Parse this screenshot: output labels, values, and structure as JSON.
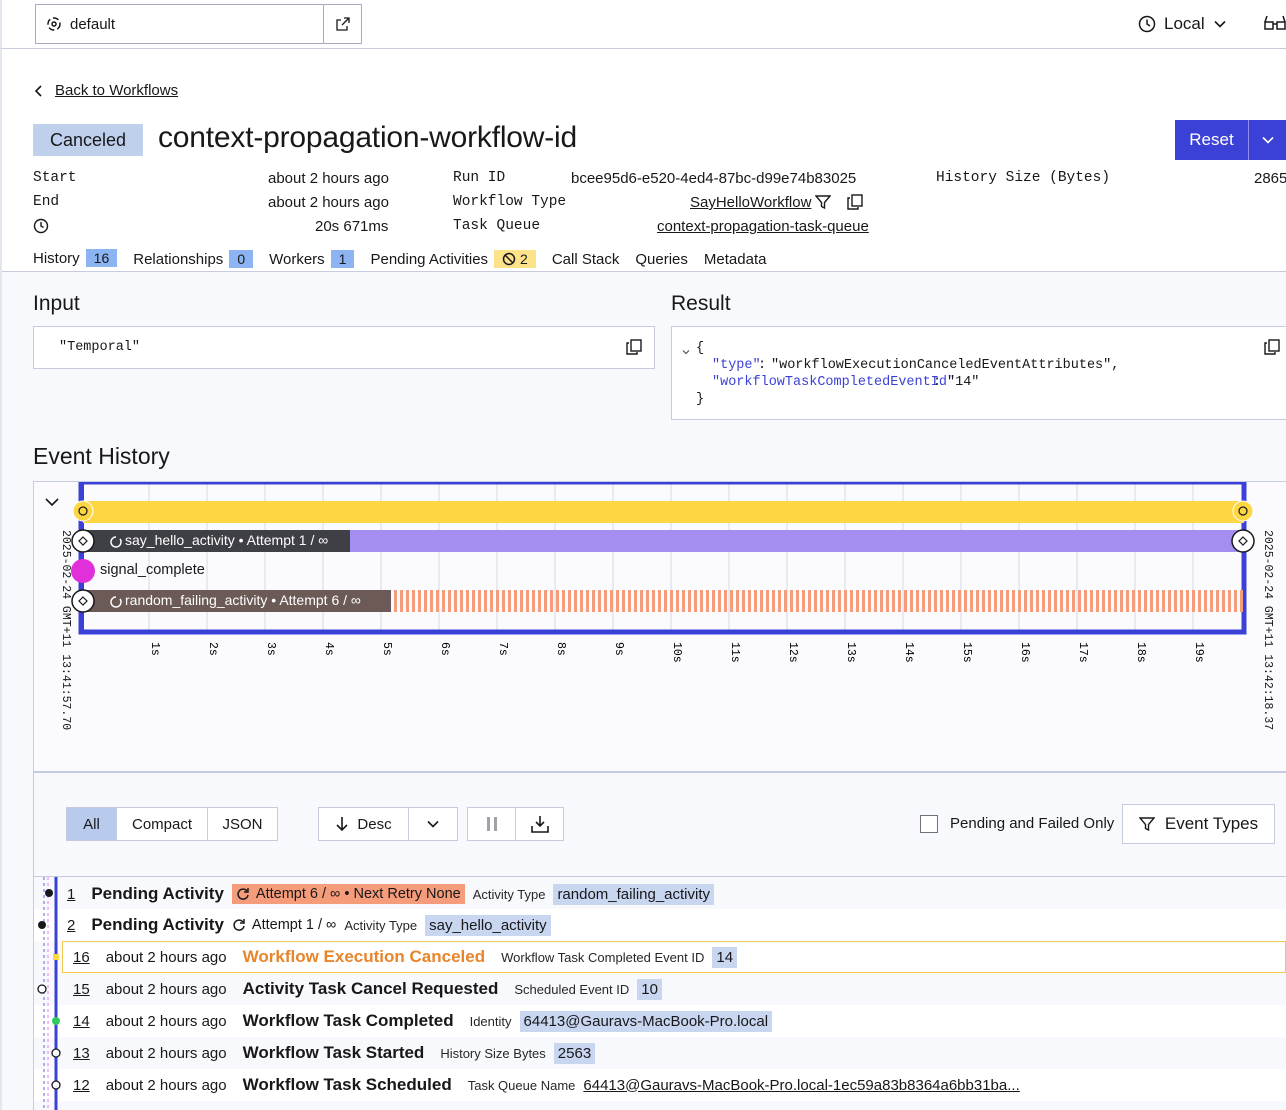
{
  "topbar": {
    "namespace": "default",
    "environment": "Local"
  },
  "back_link": "Back to Workflows",
  "workflow": {
    "status": "Canceled",
    "id": "context-propagation-workflow-id",
    "reset_label": "Reset"
  },
  "summary": {
    "start_label": "Start",
    "start_value": "about 2 hours ago",
    "end_label": "End",
    "end_value": "about 2 hours ago",
    "duration_value": "20s 671ms",
    "run_id_label": "Run ID",
    "run_id_value": "bcee95d6-e520-4ed4-87bc-d99e74b83025",
    "workflow_type_label": "Workflow Type",
    "workflow_type_value": "SayHelloWorkflow",
    "task_queue_label": "Task Queue",
    "task_queue_value": "context-propagation-task-queue",
    "history_size_label": "History Size (Bytes)",
    "history_size_value": "2865"
  },
  "tabs": [
    {
      "label": "History",
      "count": "16"
    },
    {
      "label": "Relationships",
      "count": "0"
    },
    {
      "label": "Workers",
      "count": "1"
    },
    {
      "label": "Pending Activities",
      "count": "2"
    },
    {
      "label": "Call Stack",
      "count": ""
    },
    {
      "label": "Queries",
      "count": ""
    },
    {
      "label": "Metadata",
      "count": ""
    }
  ],
  "input": {
    "heading": "Input",
    "value": "\"Temporal\""
  },
  "result": {
    "heading": "Result",
    "open_brace": "{",
    "close_brace": "}",
    "key1": "\"type\"",
    "val1": "\"workflowExecutionCanceledEventAttributes\",",
    "key2": "\"workflowTaskCompletedEventId\"",
    "val2": "\"14\""
  },
  "event_history": {
    "heading": "Event History",
    "start_stamp": "2025-02-24 GMT+11 13:41:57.70",
    "end_stamp": "2025-02-24 GMT+11 13:42:18.37",
    "ticks": [
      "1s",
      "2s",
      "3s",
      "4s",
      "5s",
      "6s",
      "7s",
      "8s",
      "9s",
      "10s",
      "11s",
      "12s",
      "13s",
      "14s",
      "15s",
      "16s",
      "17s",
      "18s",
      "19s"
    ],
    "lane_activity_1": "say_hello_activity • Attempt 1 / ∞",
    "lane_signal": "signal_complete",
    "lane_activity_2": "random_failing_activity • Attempt 6 / ∞"
  },
  "toolbar": {
    "view_all": "All",
    "view_compact": "Compact",
    "view_json": "JSON",
    "sort": "Desc",
    "pending_failed": "Pending and Failed Only",
    "event_types": "Event Types"
  },
  "pending_rows": [
    {
      "num": "1",
      "title": "Pending Activity",
      "attempt": "Attempt 6 / ∞ • Next Retry None",
      "label": "Activity Type",
      "value": "random_failing_activity"
    },
    {
      "num": "2",
      "title": "Pending Activity",
      "attempt": "Attempt 1 / ∞",
      "label": "Activity Type",
      "value": "say_hello_activity"
    }
  ],
  "events": [
    {
      "num": "16",
      "time": "about 2 hours ago",
      "title": "Workflow Execution Canceled",
      "label": "Workflow Task Completed Event ID",
      "value": "14"
    },
    {
      "num": "15",
      "time": "about 2 hours ago",
      "title": "Activity Task Cancel Requested",
      "label": "Scheduled Event ID",
      "value": "10"
    },
    {
      "num": "14",
      "time": "about 2 hours ago",
      "title": "Workflow Task Completed",
      "label": "Identity",
      "value": "64413@Gauravs-MacBook-Pro.local"
    },
    {
      "num": "13",
      "time": "about 2 hours ago",
      "title": "Workflow Task Started",
      "label": "History Size Bytes",
      "value": "2563"
    },
    {
      "num": "12",
      "time": "about 2 hours ago",
      "title": "Workflow Task Scheduled",
      "label": "Task Queue Name",
      "value": "64413@Gauravs-MacBook-Pro.local-1ec59a83b8364a6bb31ba..."
    }
  ],
  "colors": {
    "accent": "#3b41d6",
    "workflow_bar": "#fdd643",
    "activity_bar": "#a48ef2",
    "signal": "#e12fd9",
    "failing_stripe": "#f59c7a",
    "canceled_text": "#e8852b"
  }
}
